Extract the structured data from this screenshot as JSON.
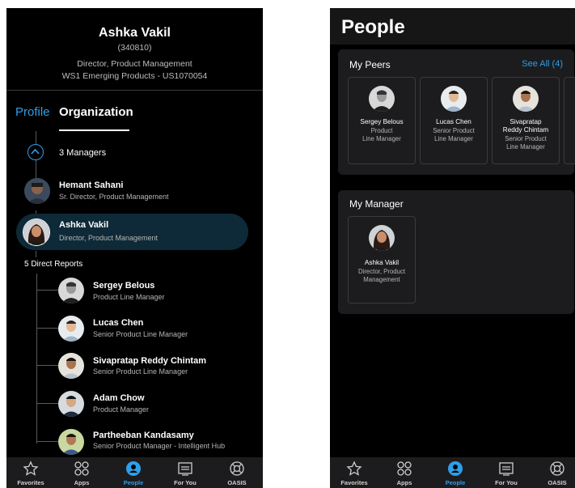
{
  "org_screen": {
    "header": {
      "name": "Ashka Vakil",
      "employee_id": "(340810)",
      "title": "Director, Product Management",
      "department": "WS1 Emerging Products - US1070054"
    },
    "tabs": [
      {
        "label": "Profile",
        "active": false
      },
      {
        "label": "Organization",
        "active": true
      }
    ],
    "managers_label": "3 Managers",
    "manager": {
      "name": "Hemant Sahani",
      "role": "Sr. Director, Product Management"
    },
    "selected": {
      "name": "Ashka Vakil",
      "role": "Director, Product Management"
    },
    "direct_reports_label": "5 Direct Reports",
    "direct_reports": [
      {
        "name": "Sergey Belous",
        "role": "Product Line Manager"
      },
      {
        "name": "Lucas Chen",
        "role": "Senior Product Line Manager"
      },
      {
        "name": "Sivapratap Reddy Chintam",
        "role": "Senior Product Line Manager"
      },
      {
        "name": "Adam Chow",
        "role": "Product Manager"
      },
      {
        "name": "Partheeban Kandasamy",
        "role": "Senior Product Manager - Intelligent Hub"
      }
    ]
  },
  "people_screen": {
    "title": "People",
    "peers": {
      "label": "My Peers",
      "see_all": "See All (4)",
      "cards": [
        {
          "name": "Sergey Belous",
          "role_line1": "Product",
          "role_line2": "Line Manager",
          "role_line3": ""
        },
        {
          "name": "Lucas Chen",
          "role_line1": "Senior Product",
          "role_line2": "Line Manager",
          "role_line3": ""
        },
        {
          "name": "Sivapratap",
          "name_line2": "Reddy Chintam",
          "role_line1": "Senior Product",
          "role_line2": "Line Manager"
        }
      ]
    },
    "manager": {
      "label": "My Manager",
      "card": {
        "name": "Ashka Vakil",
        "role_line1": "Director, Product",
        "role_line2": "Management"
      }
    }
  },
  "tab_bar": [
    {
      "label": "Favorites",
      "icon": "star-icon",
      "active": false
    },
    {
      "label": "Apps",
      "icon": "apps-grid-icon",
      "active": false
    },
    {
      "label": "People",
      "icon": "people-icon",
      "active": true
    },
    {
      "label": "For You",
      "icon": "for-you-icon",
      "active": false
    },
    {
      "label": "OASIS",
      "icon": "lifebuoy-icon",
      "active": false
    }
  ],
  "colors": {
    "accent": "#2e9fe8",
    "background": "#000000",
    "card": "#1c1c1e",
    "selected": "#0e2a38"
  }
}
